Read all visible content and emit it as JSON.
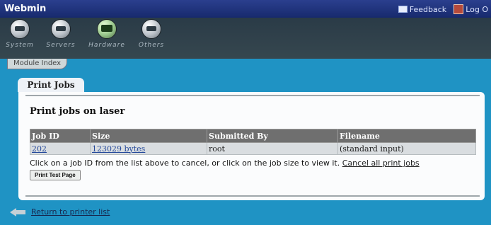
{
  "header": {
    "title": "Webmin",
    "feedback_label": "Feedback",
    "logout_label": "Log O"
  },
  "categories": [
    {
      "label": "System",
      "icon": "system-icon"
    },
    {
      "label": "Servers",
      "icon": "servers-icon"
    },
    {
      "label": "Hardware",
      "icon": "hardware-icon"
    },
    {
      "label": "Others",
      "icon": "others-icon"
    }
  ],
  "module_index_label": "Module Index",
  "page": {
    "tab_label": "Print Jobs",
    "heading": "Print jobs on laser",
    "table": {
      "headers": [
        "Job ID",
        "Size",
        "Submitted By",
        "Filename"
      ],
      "rows": [
        [
          "202",
          "123029 bytes",
          "root",
          "(standard input)"
        ]
      ]
    },
    "hint_text": "Click on a job ID from the list above to cancel, or click on the job size to view it.",
    "cancel_all_label": "Cancel all print jobs",
    "test_page_button": "Print Test Page"
  },
  "footer": {
    "return_label": "Return to printer list"
  },
  "colors": {
    "background": "#1f93c4",
    "titlebar": "#172a6d",
    "toolbar": "#36474f",
    "table_header": "#6f6f6f"
  }
}
